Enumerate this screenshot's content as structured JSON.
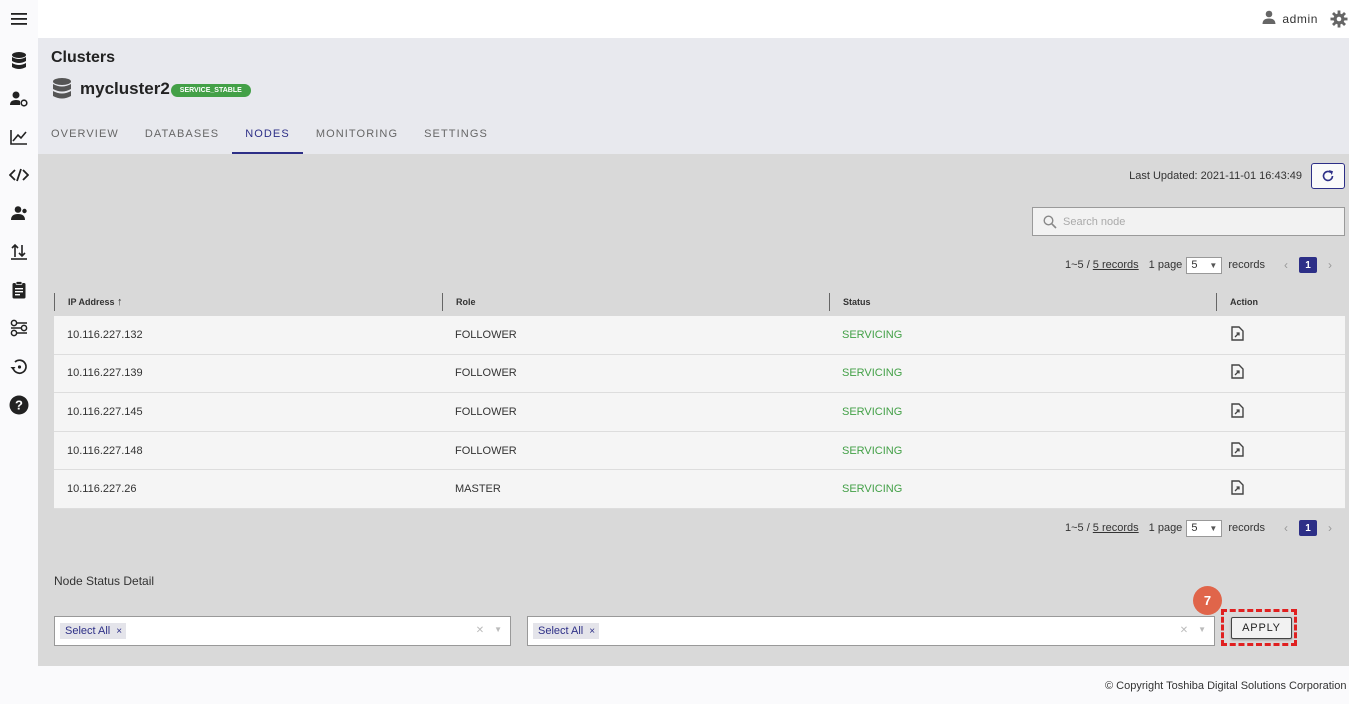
{
  "topbar": {
    "user_name": "admin"
  },
  "header": {
    "title": "Clusters",
    "cluster_name": "mycluster2",
    "cluster_status": "SERVICE_STABLE",
    "tabs": [
      {
        "label": "OVERVIEW"
      },
      {
        "label": "DATABASES"
      },
      {
        "label": "NODES",
        "active": true
      },
      {
        "label": "MONITORING"
      },
      {
        "label": "SETTINGS"
      }
    ]
  },
  "nodes": {
    "last_updated": "Last Updated: 2021-11-01 16:43:49",
    "search": {
      "placeholder": "Search node",
      "value": ""
    },
    "pagination": {
      "range": "1~5 /",
      "records_link": "5 records",
      "page_label": "1 page",
      "page_size": "5",
      "records_label": "records",
      "current_page": "1"
    },
    "table": {
      "columns": [
        "IP Address",
        "Role",
        "Status",
        "Action"
      ],
      "sort_indicator": "↑",
      "rows": [
        {
          "ip": "10.116.227.132",
          "role": "FOLLOWER",
          "status": "SERVICING"
        },
        {
          "ip": "10.116.227.139",
          "role": "FOLLOWER",
          "status": "SERVICING"
        },
        {
          "ip": "10.116.227.145",
          "role": "FOLLOWER",
          "status": "SERVICING"
        },
        {
          "ip": "10.116.227.148",
          "role": "FOLLOWER",
          "status": "SERVICING"
        },
        {
          "ip": "10.116.227.26",
          "role": "MASTER",
          "status": "SERVICING"
        }
      ]
    },
    "detail": {
      "title": "Node Status Detail",
      "filter1_chip": "Select All",
      "filter2_chip": "Select All",
      "apply_label": "APPLY",
      "step_number": "7"
    }
  },
  "footer": {
    "copyright": "© Copyright Toshiba Digital Solutions Corporation"
  },
  "colors": {
    "accent": "#2d2f87",
    "success": "#43a047",
    "highlight": "#e02020",
    "step_marker": "#e0654a"
  }
}
